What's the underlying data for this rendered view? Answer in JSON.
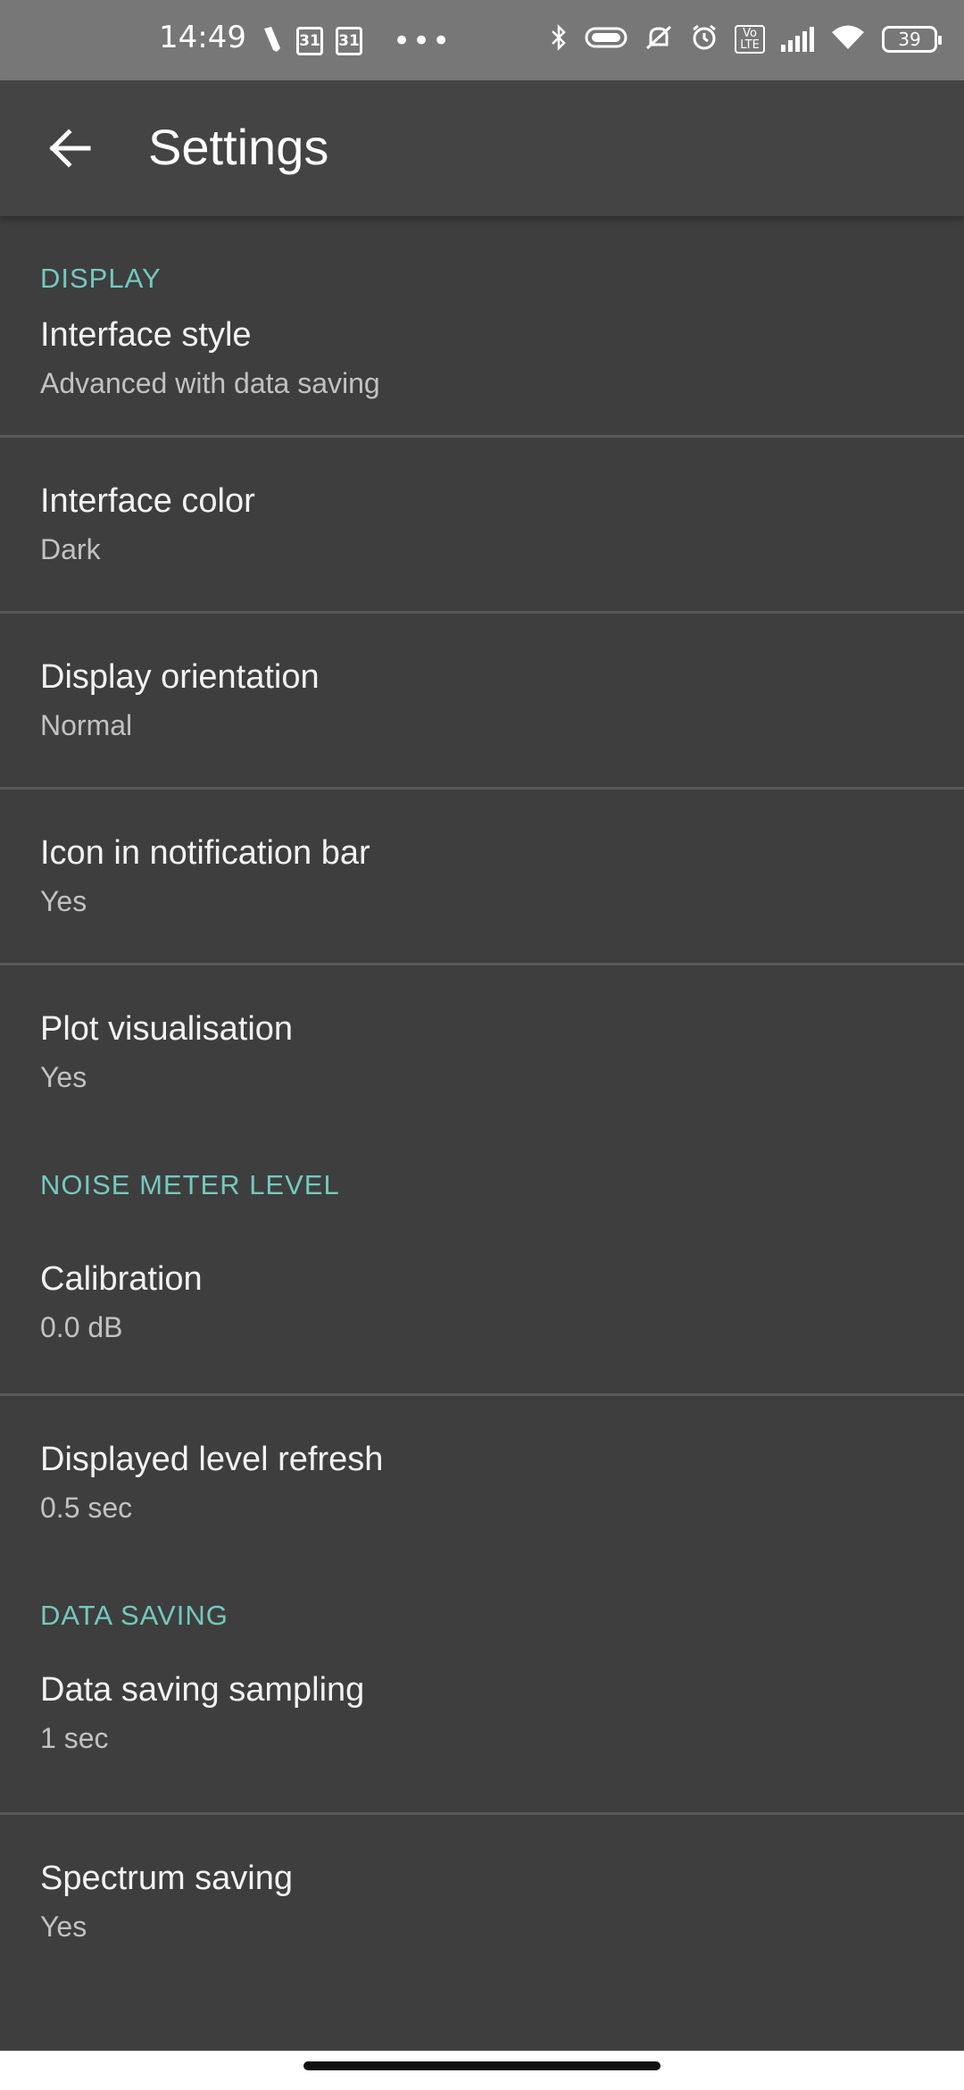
{
  "status_bar": {
    "time": "14:49",
    "calendar_1": "31",
    "calendar_2": "31",
    "more": "•••",
    "volte": "Vo LTE",
    "battery": "39",
    "icons": [
      "pen-icon",
      "calendar-icon",
      "calendar-icon",
      "more-icon",
      "bluetooth-icon",
      "battery-saver-icon",
      "mute-icon",
      "alarm-icon",
      "volte-icon",
      "signal-icon",
      "wifi-icon",
      "battery-icon"
    ]
  },
  "app_bar": {
    "title": "Settings",
    "back_icon": "arrow-back-icon"
  },
  "sections": {
    "display": {
      "header": "DISPLAY",
      "items": [
        {
          "title": "Interface style",
          "value": "Advanced with data saving"
        },
        {
          "title": "Interface color",
          "value": "Dark"
        },
        {
          "title": "Display orientation",
          "value": "Normal"
        },
        {
          "title": "Icon in notification bar",
          "value": "Yes"
        },
        {
          "title": "Plot visualisation",
          "value": "Yes"
        }
      ]
    },
    "noise": {
      "header": "NOISE METER LEVEL",
      "items": [
        {
          "title": "Calibration",
          "value": "0.0 dB"
        },
        {
          "title": "Displayed level refresh",
          "value": "0.5 sec"
        }
      ]
    },
    "data_saving": {
      "header": "DATA SAVING",
      "items": [
        {
          "title": "Data saving sampling",
          "value": "1 sec"
        },
        {
          "title": "Spectrum saving",
          "value": "Yes"
        }
      ]
    }
  },
  "colors": {
    "background": "#3e3e3e",
    "app_bar": "#444444",
    "status_bar": "#777777",
    "accent": "#74c9bf",
    "divider": "#5a5a5a"
  }
}
